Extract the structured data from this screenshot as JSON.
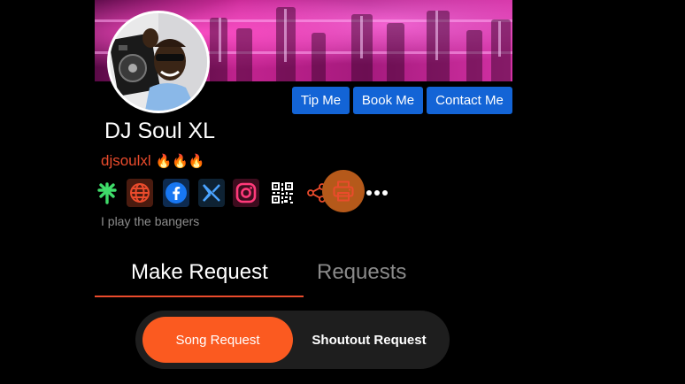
{
  "profile": {
    "name": "DJ Soul XL",
    "handle": "djsoulxl",
    "handle_emoji": "🔥🔥🔥",
    "bio": "I play the bangers"
  },
  "actions": {
    "tip": "Tip Me",
    "book": "Book Me",
    "contact": "Contact Me"
  },
  "social_icons": [
    "linktree-icon",
    "globe-icon",
    "facebook-icon",
    "x-icon",
    "instagram-icon",
    "qr-code-icon",
    "share-icon",
    "print-icon",
    "more-icon"
  ],
  "tabs": {
    "make_request": "Make Request",
    "requests": "Requests",
    "active": "make_request"
  },
  "request_type": {
    "song": "Song Request",
    "shoutout": "Shoutout Request",
    "active": "song"
  },
  "colors": {
    "accent": "#ea4b2c",
    "toggle_active": "#fb5a20",
    "button_blue": "#1364d6"
  }
}
